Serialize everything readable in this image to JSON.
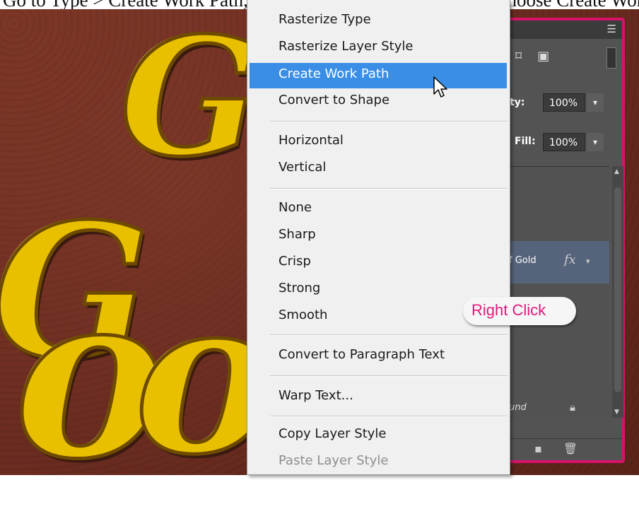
{
  "caption": {
    "text": "Go to Type > Create Work Path, or right-click the type layer and choose Create Work Path"
  },
  "canvas": {
    "letters": [
      "G",
      "G",
      "o",
      "o"
    ]
  },
  "layers_panel": {
    "menu_icon": "panel-menu-icon",
    "opacity_label": "city:",
    "opacity_value": "100%",
    "fill_label": "Fill:",
    "fill_value": "100%",
    "dropdown_arrow": "▾",
    "selected_layer_name": "f Gold",
    "fx_label": "fx",
    "background_layer_name": "und"
  },
  "context_menu": {
    "items": [
      {
        "label": "Rasterize Type",
        "state": "normal"
      },
      {
        "label": "Rasterize Layer Style",
        "state": "normal"
      },
      {
        "label": "Create Work Path",
        "state": "highlighted"
      },
      {
        "label": "Convert to Shape",
        "state": "normal"
      },
      {
        "label": "Horizontal",
        "state": "normal"
      },
      {
        "label": "Vertical",
        "state": "normal"
      },
      {
        "label": "None",
        "state": "normal"
      },
      {
        "label": "Sharp",
        "state": "normal"
      },
      {
        "label": "Crisp",
        "state": "normal"
      },
      {
        "label": "Strong",
        "state": "normal"
      },
      {
        "label": "Smooth",
        "state": "normal"
      },
      {
        "label": "Convert to Paragraph Text",
        "state": "normal"
      },
      {
        "label": "Warp Text...",
        "state": "normal"
      },
      {
        "label": "Copy Layer Style",
        "state": "normal"
      },
      {
        "label": "Paste Layer Style",
        "state": "disabled"
      }
    ]
  },
  "annotation": {
    "text": "Right Click",
    "color": "#e0197b"
  },
  "colors": {
    "highlight": "#3a8ee6",
    "panel_border": "#d7126b",
    "gold": "#e8c000"
  }
}
